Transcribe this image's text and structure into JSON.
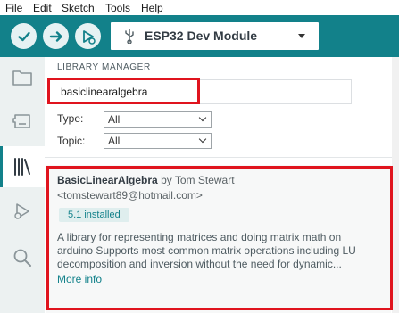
{
  "menu": [
    "File",
    "Edit",
    "Sketch",
    "Tools",
    "Help"
  ],
  "toolbar": {
    "verify_icon": "check-icon",
    "upload_icon": "arrow-right-icon",
    "debug_icon": "debug-icon",
    "board_name": "ESP32 Dev Module"
  },
  "sidebar": {
    "items": [
      "sketchbook-icon",
      "boards-manager-icon",
      "library-manager-icon",
      "debug-icon",
      "search-icon"
    ],
    "active": "library-manager-icon"
  },
  "library_manager": {
    "title": "LIBRARY MANAGER",
    "search_value": "basiclinearalgebra",
    "type_label": "Type:",
    "type_value": "All",
    "topic_label": "Topic:",
    "topic_value": "All"
  },
  "result": {
    "name": "BasicLinearAlgebra",
    "author": "by Tom Stewart",
    "email": "<tomstewart89@hotmail.com>",
    "installed": "5.1 installed",
    "description": "A library for representing matrices and doing matrix math on arduino Supports most common matrix operations including LU decomposition and inversion without the need for dynamic...",
    "more_info": "More info"
  },
  "colors": {
    "toolbar": "#12818a",
    "highlight": "#e0141e",
    "accent": "#12818a"
  }
}
